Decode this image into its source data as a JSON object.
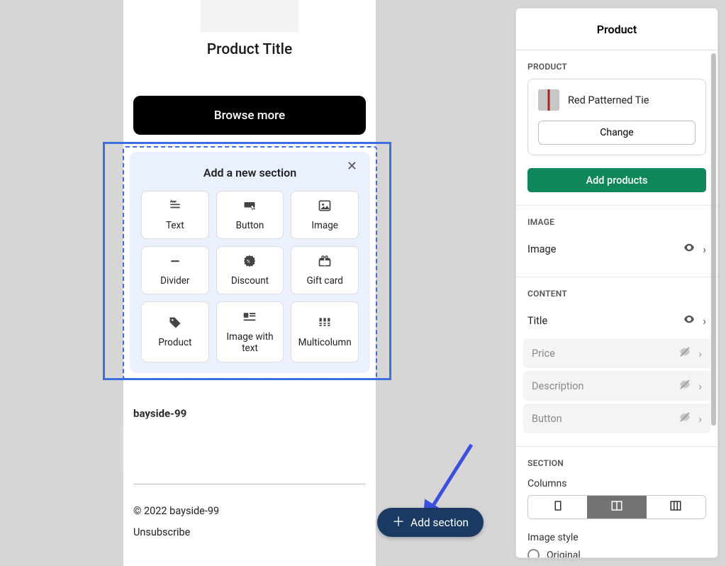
{
  "preview": {
    "product_title": "Product Title",
    "browse_label": "Browse more",
    "footer_name": "bayside-99",
    "copyright": "© 2022 bayside-99",
    "unsubscribe": "Unsubscribe"
  },
  "selector": {
    "title": "Add a new section",
    "items": [
      {
        "label": "Text",
        "icon": "text"
      },
      {
        "label": "Button",
        "icon": "button"
      },
      {
        "label": "Image",
        "icon": "image"
      },
      {
        "label": "Divider",
        "icon": "divider"
      },
      {
        "label": "Discount",
        "icon": "discount"
      },
      {
        "label": "Gift card",
        "icon": "giftcard"
      },
      {
        "label": "Product",
        "icon": "product"
      },
      {
        "label": "Image with text",
        "icon": "imgtext"
      },
      {
        "label": "Multicolumn",
        "icon": "multicolumn"
      }
    ]
  },
  "add_section_label": "Add section",
  "sidebar": {
    "title": "Product",
    "product_group": "PRODUCT",
    "product_name": "Red Patterned Tie",
    "change_label": "Change",
    "add_products_label": "Add products",
    "image_group": "IMAGE",
    "image_row": "Image",
    "content_group": "CONTENT",
    "content_rows": [
      {
        "label": "Title",
        "visible": true
      },
      {
        "label": "Price",
        "visible": false
      },
      {
        "label": "Description",
        "visible": false
      },
      {
        "label": "Button",
        "visible": false
      }
    ],
    "section_group": "SECTION",
    "columns_label": "Columns",
    "columns_selected_index": 1,
    "image_style_label": "Image style",
    "image_style_options": [
      "Original"
    ]
  }
}
